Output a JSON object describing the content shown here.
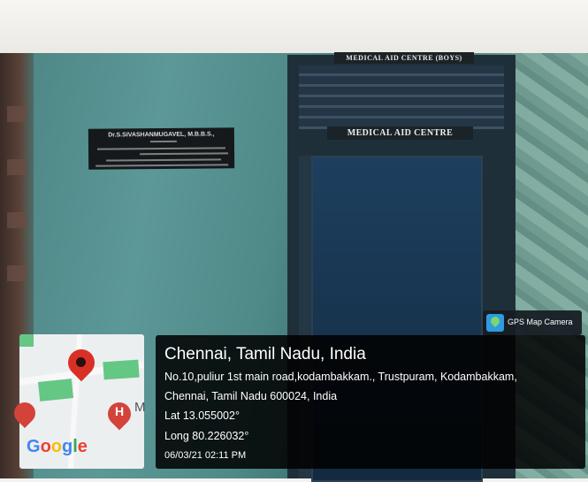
{
  "signs": {
    "top": "MEDICAL AID CENTRE (BOYS)",
    "main": "MEDICAL AID CENTRE",
    "plaque_name": "Dr.S.SIVASHANMUGAVEL, M.B.B.S.,"
  },
  "gps_badge": {
    "label": "GPS Map Camera",
    "icon": "gps-map-camera-icon"
  },
  "map": {
    "brand": "Google",
    "partial_label": "M",
    "pin_icon": "location-pin-icon",
    "hospital_icon": "hospital-marker-icon",
    "hospital_letter": "H",
    "colors": {
      "pin": "#d93025",
      "park": "#64c784"
    }
  },
  "location": {
    "city_line": "Chennai, Tamil Nadu, India",
    "address_line1": "No.10,puliur 1st main road,kodambakkam., Trustpuram, Kodambakkam,",
    "address_line2": "Chennai, Tamil Nadu 600024, India",
    "lat": "Lat 13.055002°",
    "long": "Long 80.226032°",
    "datetime": "06/03/21 02:11 PM"
  }
}
